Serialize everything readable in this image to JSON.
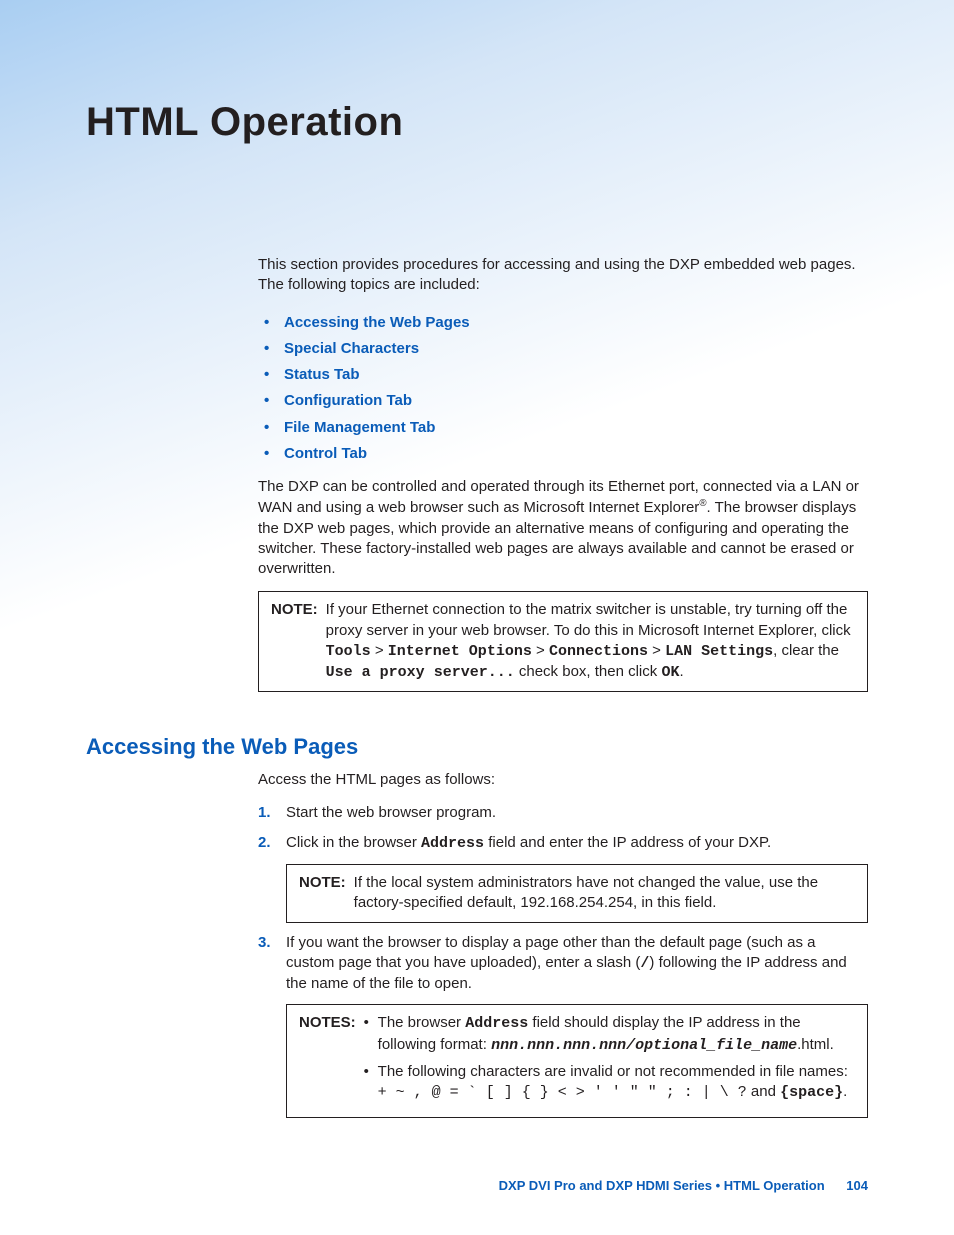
{
  "title": "HTML Operation",
  "intro": "This section provides procedures for accessing and using the DXP embedded web pages. The following topics are included:",
  "toc": [
    "Accessing the Web Pages",
    "Special Characters",
    "Status Tab",
    "Configuration Tab",
    "File Management Tab",
    "Control Tab"
  ],
  "para1_a": "The DXP can be controlled and operated through its Ethernet port, connected via a LAN or WAN and using a web browser such as Microsoft Internet Explorer",
  "para1_reg": "®",
  "para1_b": ". The browser displays the DXP web pages, which provide an alternative means of configuring and operating the switcher. These factory-installed web pages are always available and cannot be erased or overwritten.",
  "note1": {
    "label": "NOTE:",
    "pre": "If your Ethernet connection to the matrix switcher is unstable, try turning off the proxy server in your web browser. To do this in Microsoft Internet Explorer, click ",
    "m1": "Tools",
    "gt1": " > ",
    "m2": "Internet Options",
    "gt2": " > ",
    "m3": "Connections",
    "gt3": " > ",
    "m4": "LAN Settings",
    "mid": ", clear the ",
    "m5": "Use a proxy server...",
    "mid2": " check box, then click ",
    "m6": "OK",
    "end": "."
  },
  "h2": "Accessing the Web Pages",
  "access_intro": "Access the HTML pages as follows:",
  "step1": "Start the web browser program.",
  "step2_a": "Click in the browser ",
  "step2_m": "Address",
  "step2_b": " field and enter the IP address of your DXP.",
  "note2": {
    "label": "NOTE:",
    "text": "If the local system administrators have not changed the value, use the factory-specified default, 192.168.254.254, in this field."
  },
  "step3_a": "If you want the browser to display a page other than the default page (such as a custom page that you have uploaded), enter a slash (",
  "step3_m": "/",
  "step3_b": ") following the IP address and the name of the file to open.",
  "notes3": {
    "label": "NOTES:",
    "b1_a": "The browser ",
    "b1_m1": "Address",
    "b1_b": " field should display the IP address in the following format: ",
    "b1_m2": "nnn.nnn.nnn.nnn/optional_file_name",
    "b1_c": ".html.",
    "b2_a": "The following characters are invalid or not recommended in file names:",
    "b2_m": "+ ~ , @ = ` [ ] { } < > ' ' \" \" ; : | \\ ?",
    "b2_b": " and ",
    "b2_m2": "{space}",
    "b2_c": "."
  },
  "footer": {
    "text": "DXP DVI Pro and DXP HDMI Series • HTML Operation",
    "page": "104"
  }
}
